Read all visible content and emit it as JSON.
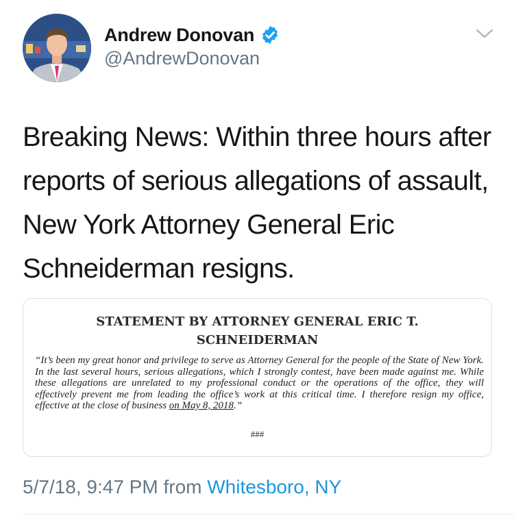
{
  "author": {
    "display_name": "Andrew Donovan",
    "handle": "@AndrewDonovan",
    "verified": true,
    "avatar_icon": "profile-photo"
  },
  "tweet": {
    "text": "Breaking News: Within three hours after reports of serious allegations of assault, New York Attorney General Eric Schneiderman resigns.",
    "date_time": "5/7/18, 9:47 PM",
    "source_prefix": "from",
    "location": "Whitesboro, NY"
  },
  "statement": {
    "title_line1": "STATEMENT BY ATTORNEY GENERAL ERIC T.",
    "title_line2": "SCHNEIDERMAN",
    "body_start": "“It’s been my great honor and privilege to serve as Attorney General for the people of the State of New York. In the last several hours, serious allegations, which I strongly contest, have been made against me. While these allegations are unrelated to my professional conduct or the operations of the office, they will effectively prevent me from leading the office’s work at this critical time. I therefore resign my office, effective at the close of business ",
    "body_underlined": "on May 8, 2018",
    "body_end": ".”",
    "end_mark": "###"
  },
  "icons": {
    "verified": "verified-badge-icon",
    "menu": "chevron-down-icon"
  },
  "colors": {
    "primary_text": "#14171a",
    "secondary_text": "#657786",
    "link": "#1b95e0",
    "verified_badge": "#1da1f2"
  }
}
